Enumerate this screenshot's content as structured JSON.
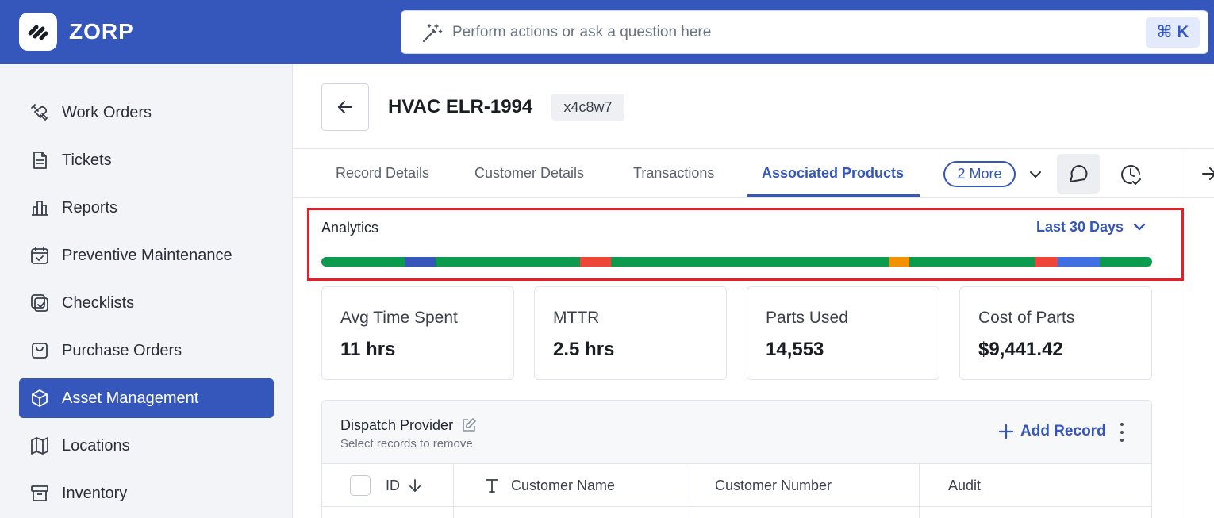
{
  "brand": {
    "name": "ZORP",
    "logo_icon": "zorp-logo-icon"
  },
  "search": {
    "placeholder": "Perform actions or ask a question here",
    "shortcut": "⌘ K",
    "icon": "magic-wand-icon"
  },
  "sidebar": {
    "items": [
      {
        "label": "Work Orders",
        "icon": "tools-icon",
        "active": false
      },
      {
        "label": "Tickets",
        "icon": "document-icon",
        "active": false
      },
      {
        "label": "Reports",
        "icon": "bar-chart-icon",
        "active": false
      },
      {
        "label": "Preventive Maintenance",
        "icon": "calendar-check-icon",
        "active": false
      },
      {
        "label": "Checklists",
        "icon": "checklist-icon",
        "active": false
      },
      {
        "label": "Purchase Orders",
        "icon": "shopping-bag-icon",
        "active": false
      },
      {
        "label": "Asset Management",
        "icon": "cube-icon",
        "active": true
      },
      {
        "label": "Locations",
        "icon": "map-icon",
        "active": false
      },
      {
        "label": "Inventory",
        "icon": "archive-icon",
        "active": false
      }
    ]
  },
  "header": {
    "title": "HVAC ELR-1994",
    "record_id": "x4c8w7"
  },
  "tabs": {
    "items": [
      {
        "label": "Record Details",
        "active": false
      },
      {
        "label": "Customer Details",
        "active": false
      },
      {
        "label": "Transactions",
        "active": false
      },
      {
        "label": "Associated Products",
        "active": true
      }
    ],
    "more_label": "2 More"
  },
  "analytics": {
    "label": "Analytics",
    "range": "Last 30 Days",
    "status_bar": [
      {
        "fraction": 0.1,
        "color": "#0c9a4f"
      },
      {
        "fraction": 0.038,
        "color": "#3556bb"
      },
      {
        "fraction": 0.173,
        "color": "#0c9a4f"
      },
      {
        "fraction": 0.038,
        "color": "#f0463a"
      },
      {
        "fraction": 0.334,
        "color": "#0c9a4f"
      },
      {
        "fraction": 0.025,
        "color": "#f39200"
      },
      {
        "fraction": 0.151,
        "color": "#0c9a4f"
      },
      {
        "fraction": 0.027,
        "color": "#f0463a"
      },
      {
        "fraction": 0.051,
        "color": "#3f6fe0"
      },
      {
        "fraction": 0.063,
        "color": "#0c9a4f"
      }
    ]
  },
  "kpis": [
    {
      "label": "Avg Time Spent",
      "value": "11 hrs"
    },
    {
      "label": "MTTR",
      "value": "2.5 hrs"
    },
    {
      "label": "Parts Used",
      "value": "14,553"
    },
    {
      "label": "Cost of Parts",
      "value": "$9,441.42"
    }
  ],
  "dispatch": {
    "title": "Dispatch Provider",
    "subtitle": "Select records to remove",
    "add_label": "Add Record",
    "columns": {
      "id": "ID",
      "customer_name": "Customer Name",
      "customer_number": "Customer Number",
      "audit": "Audit"
    }
  },
  "colors": {
    "primary": "#3556bb",
    "highlight": "#ec1c24"
  }
}
